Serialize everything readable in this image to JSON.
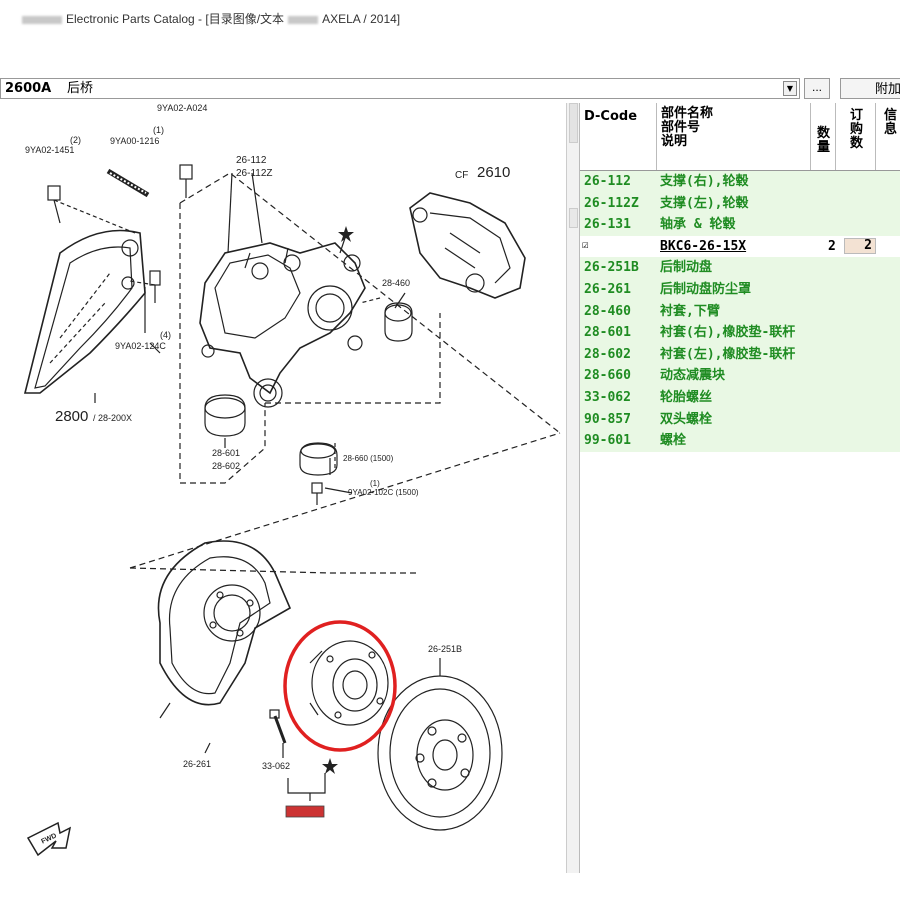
{
  "window": {
    "title_prefix": "Electronic Parts Catalog - [目录图像/文本",
    "title_suffix": "AXELA / 2014]"
  },
  "group_selector": {
    "code": "2600A",
    "name": "后桥"
  },
  "buttons": {
    "browse": "...",
    "attach": "附加"
  },
  "table": {
    "headers": {
      "dcode": "D-Code",
      "name": [
        "部件名称",
        "部件号",
        "说明"
      ],
      "qty": [
        "数",
        "量"
      ],
      "order": [
        "订",
        "购",
        "数"
      ],
      "info": [
        "信",
        "息"
      ]
    },
    "rows": [
      {
        "code": "26-112",
        "name": "支撑(右),轮毂"
      },
      {
        "code": "26-112Z",
        "name": "支撑(左),轮毂"
      },
      {
        "code": "26-131",
        "name": "轴承 & 轮毂"
      },
      {
        "code": "26-251B",
        "name": "后制动盘"
      },
      {
        "code": "26-261",
        "name": "后制动盘防尘罩"
      },
      {
        "code": "28-460",
        "name": "衬套,下臂"
      },
      {
        "code": "28-601",
        "name": "衬套(右),橡胶垫-联杆"
      },
      {
        "code": "28-602",
        "name": "衬套(左),橡胶垫-联杆"
      },
      {
        "code": "28-660",
        "name": "动态减震块"
      },
      {
        "code": "33-062",
        "name": "轮胎螺丝"
      },
      {
        "code": "90-857",
        "name": "双头螺栓"
      },
      {
        "code": "99-601",
        "name": "螺栓"
      }
    ],
    "sub_row": {
      "part_no": "BKC6-26-15X",
      "qty": "2",
      "order_qty": "2"
    }
  },
  "diagram_labels": {
    "l_9ya02a024": "9YA02-A024",
    "l_2": "(2)",
    "l_9ya02_1451": "9YA02-1451",
    "l_1a": "(1)",
    "l_9ya00_1216": "9YA00-1216",
    "l_26112": "26-112",
    "l_26112z": "26-112Z",
    "l_cf": "CF",
    "l_2610": "2610",
    "l_28460": "28-460",
    "l_4": "(4)",
    "l_9ya02_124c": "9YA02-124C",
    "l_2800": "2800",
    "l_28200x": "/ 28-200X",
    "l_28601": "28-601",
    "l_28602": "28-602",
    "l_28660": "28-660 (1500)",
    "l_1b": "(1)",
    "l_9ya02_102c": "9YA02-102C (1500)",
    "l_26251b": "26-251B",
    "l_26261": "26-261",
    "l_33062": "33-062",
    "l_star": "★",
    "l_fwd": "FWD"
  },
  "colors": {
    "green_text": "#1f8c22",
    "green_bg": "#e9f8e4",
    "highlight": "#e02020"
  }
}
